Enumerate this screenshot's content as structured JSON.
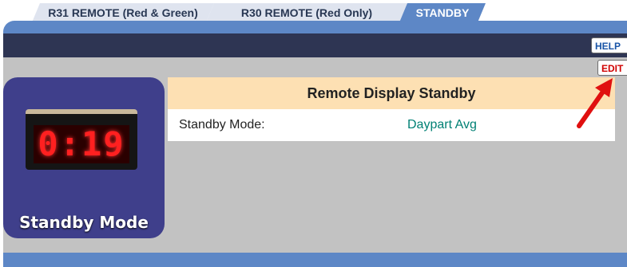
{
  "tabs": [
    {
      "label": "R31 REMOTE (Red & Green)",
      "active": false
    },
    {
      "label": "R30 REMOTE (Red Only)",
      "active": false
    },
    {
      "label": "STANDBY",
      "active": true
    }
  ],
  "toolbar": {
    "help_label": "HELP",
    "edit_label": "EDIT"
  },
  "image_panel": {
    "clock_display": "0:19",
    "caption": "Standby Mode"
  },
  "table": {
    "title": "Remote Display Standby",
    "rows": [
      {
        "label": "Standby Mode:",
        "value": "Daypart Avg"
      }
    ]
  },
  "colors": {
    "frame": "#5d87c6",
    "navbar": "#2e3553",
    "content": "#c2c2c2",
    "header": "#fde0b3",
    "value_text": "#008074",
    "edit_text": "#d00000",
    "help_text": "#1a55a7",
    "arrow": "#e01010"
  },
  "icons": {
    "pointer": "red-arrow-icon"
  }
}
